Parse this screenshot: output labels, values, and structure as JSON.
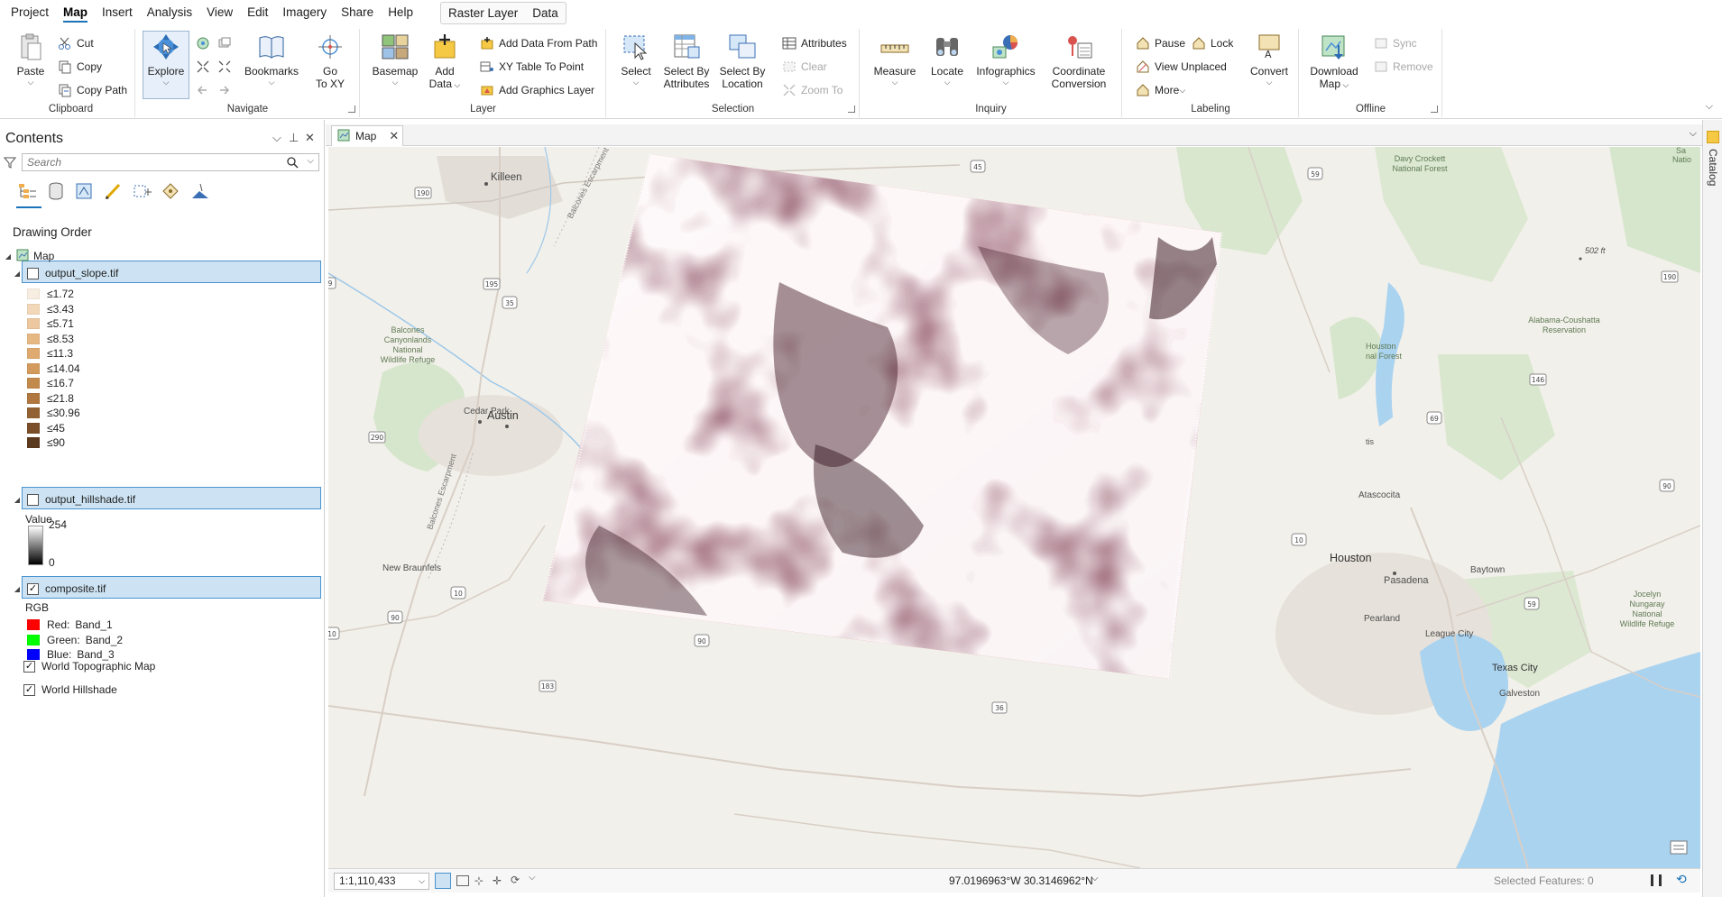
{
  "menu": {
    "tabs": [
      "Project",
      "Map",
      "Insert",
      "Analysis",
      "View",
      "Edit",
      "Imagery",
      "Share",
      "Help"
    ],
    "active_tab": "Map",
    "context_tabs": [
      "Raster Layer",
      "Data"
    ]
  },
  "ribbon": {
    "clipboard": {
      "title": "Clipboard",
      "paste": "Paste",
      "cut": "Cut",
      "copy": "Copy",
      "copy_path": "Copy Path"
    },
    "navigate": {
      "title": "Navigate",
      "explore": "Explore",
      "bookmarks": "Bookmarks",
      "go_to_xy_1": "Go",
      "go_to_xy_2": "To XY"
    },
    "layer": {
      "title": "Layer",
      "basemap": "Basemap",
      "add_data_1": "Add",
      "add_data_2": "Data",
      "add_from_path": "Add Data From Path",
      "xy_table": "XY Table To Point",
      "add_graphics": "Add Graphics Layer"
    },
    "selection": {
      "title": "Selection",
      "select": "Select",
      "select_by_attr_1": "Select By",
      "select_by_attr_2": "Attributes",
      "select_by_loc_1": "Select By",
      "select_by_loc_2": "Location",
      "attributes": "Attributes",
      "clear": "Clear",
      "zoom_to": "Zoom To"
    },
    "inquiry": {
      "title": "Inquiry",
      "measure": "Measure",
      "locate": "Locate",
      "infographics": "Infographics",
      "coord_conv_1": "Coordinate",
      "coord_conv_2": "Conversion"
    },
    "labeling": {
      "title": "Labeling",
      "pause": "Pause",
      "lock": "Lock",
      "view_unplaced": "View Unplaced",
      "more": "More",
      "convert": "Convert"
    },
    "offline": {
      "title": "Offline",
      "download_map_1": "Download",
      "download_map_2": "Map",
      "sync": "Sync",
      "remove": "Remove"
    }
  },
  "contents": {
    "title": "Contents",
    "search_placeholder": "Search",
    "drawing_order": "Drawing Order",
    "map_label": "Map",
    "layers": {
      "slope": {
        "name": "output_slope.tif",
        "checked": false,
        "classes": [
          {
            "label": "≤1.72",
            "color": "#f7ede0"
          },
          {
            "label": "≤3.43",
            "color": "#f2d7b8"
          },
          {
            "label": "≤5.71",
            "color": "#ecc79f"
          },
          {
            "label": "≤8.53",
            "color": "#e6b883"
          },
          {
            "label": "≤11.3",
            "color": "#dfaa6f"
          },
          {
            "label": "≤14.04",
            "color": "#d39a5d"
          },
          {
            "label": "≤16.7",
            "color": "#c38a4d"
          },
          {
            "label": "≤21.8",
            "color": "#b07840"
          },
          {
            "label": "≤30.96",
            "color": "#936234"
          },
          {
            "label": "≤45",
            "color": "#7a4f2a"
          },
          {
            "label": "≤90",
            "color": "#5c3a1e"
          }
        ]
      },
      "hillshade": {
        "name": "output_hillshade.tif",
        "checked": false,
        "value_label": "Value",
        "max": "254",
        "min": "0"
      },
      "composite": {
        "name": "composite.tif",
        "checked": true,
        "rgb_label": "RGB",
        "bands": [
          {
            "channel": "Red:",
            "band": "Band_1",
            "color": "#ff0000"
          },
          {
            "channel": "Green:",
            "band": "Band_2",
            "color": "#00ff00"
          },
          {
            "channel": "Blue:",
            "band": "Band_3",
            "color": "#0000ff"
          }
        ]
      },
      "basemaps": [
        {
          "name": "World Topographic Map",
          "checked": true
        },
        {
          "name": "World Hillshade",
          "checked": true
        }
      ]
    }
  },
  "map_view": {
    "tab_label": "Map",
    "places": {
      "killeen": "Killeen",
      "austin": "Austin",
      "cedar_park": "Cedar Park",
      "new_braunfels": "New Braunfels",
      "balcones_refuge_1": "Balcones",
      "balcones_refuge_2": "Canyonlands",
      "balcones_refuge_3": "National",
      "balcones_refuge_4": "Wildlife Refuge",
      "balcones_escarpment": "Balcones Escarpment",
      "balcones_escarpment_2": "Balcones Escarpment",
      "houston": "Houston",
      "pasadena": "Pasadena",
      "baytown": "Baytown",
      "pearland": "Pearland",
      "league_city": "League City",
      "texas_city": "Texas City",
      "galveston": "Galveston",
      "atascocita": "Atascocita",
      "davy_crockett_1": "Davy Crockett",
      "davy_crockett_2": "National Forest",
      "alabama_1": "Alabama-Coushatta",
      "alabama_2": "Reservation",
      "houston_forest_1": "Houston",
      "houston_forest_2": "nal Forest",
      "jocelyn_1": "Jocelyn",
      "jocelyn_2": "Nungaray",
      "jocelyn_3": "National",
      "jocelyn_4": "Wildlife Refuge",
      "nation_1": "Sa",
      "nation_2": "Natio",
      "elevation": "502 ft",
      "tis": "tis"
    },
    "shields": [
      "190",
      "45",
      "59",
      "195",
      "35",
      "290",
      "190",
      "146",
      "69",
      "90",
      "10",
      "10",
      "90",
      "90",
      "183",
      "36",
      "10",
      "9",
      "59"
    ],
    "scale": "1:1,110,433",
    "coordinates": "97.0196963°W 30.3146962°N",
    "selected_features": "Selected Features: 0"
  },
  "catalog": {
    "label": "Catalog"
  }
}
